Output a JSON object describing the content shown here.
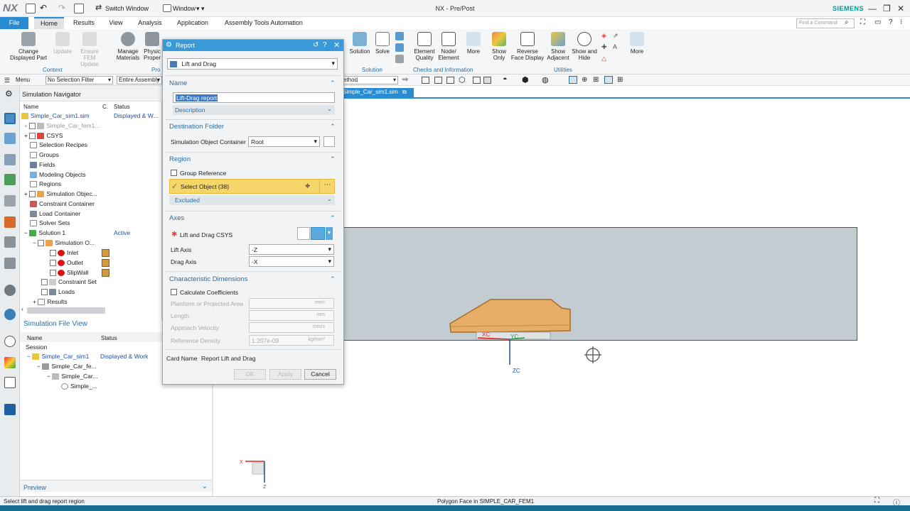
{
  "app": {
    "logo": "NX",
    "window_title": "NX - Pre/Post",
    "brand": "SIEMENS",
    "switch_window": "Switch Window",
    "window_menu": "Window"
  },
  "tabs": [
    "File",
    "Home",
    "Results",
    "View",
    "Analysis",
    "Application",
    "Assembly Tools Automation"
  ],
  "find_command": "Find a Command",
  "ribbon": {
    "change_part": "Change Displayed Part",
    "update": "Update",
    "update_fem": "Ensure FEM Update",
    "manage_materials": "Manage Materials",
    "physical": "Physic Proper",
    "solution": "Solution",
    "solve": "Solve",
    "element_quality": "Element Quality",
    "node_element": "Node/ Element",
    "more": "More",
    "show_only": "Show Only",
    "reverse_face": "Reverse Face Display",
    "show_adjacent": "Show Adjacent",
    "show_hide": "Show and Hide",
    "more2": "More",
    "groups": {
      "context": "Context",
      "prop": "Pro",
      "solution": "Solution",
      "checks": "Checks and Information",
      "utilities": "Utilities"
    }
  },
  "cmdbar": {
    "menu": "Menu",
    "filter": "No Selection Filter",
    "scope": "Entire Assembly",
    "method": "ethod"
  },
  "navigator": {
    "title": "Simulation Navigator",
    "col_name": "Name",
    "col_c": "C.",
    "col_status": "Status",
    "items": [
      {
        "label": "Simple_Car_sim1.sim",
        "status": "Displayed & W..."
      },
      {
        "label": "Simple_Car_fem1..."
      },
      {
        "label": "CSYS"
      },
      {
        "label": "Selection Recipes"
      },
      {
        "label": "Groups"
      },
      {
        "label": "Fields"
      },
      {
        "label": "Modeling Objects"
      },
      {
        "label": "Regions"
      },
      {
        "label": "Simulation Objec..."
      },
      {
        "label": "Constraint Container"
      },
      {
        "label": "Load Container"
      },
      {
        "label": "Solver Sets"
      },
      {
        "label": "Solution 1",
        "status": "Active"
      },
      {
        "label": "Simulation O..."
      },
      {
        "label": "Inlet"
      },
      {
        "label": "Outlet"
      },
      {
        "label": "SlipWall"
      },
      {
        "label": "Constraint Set"
      },
      {
        "label": "Loads"
      },
      {
        "label": "Results"
      }
    ]
  },
  "fileview": {
    "title": "Simulation File View",
    "col_name": "Name",
    "col_status": "Status",
    "session": "Session",
    "items": [
      {
        "label": "Simple_Car_sim1",
        "status": "Displayed & Work"
      },
      {
        "label": "Simple_Car_fe..."
      },
      {
        "label": "Simple_Car..."
      },
      {
        "label": "Simple_..."
      }
    ],
    "preview": "Preview"
  },
  "graphics": {
    "tab": "Simple_Car_sim1.sim",
    "xc": "XC",
    "yc": "YC",
    "zc": "ZC",
    "triad_x": "X",
    "triad_z": "Z"
  },
  "dialog": {
    "title": "Report",
    "type": "Lift and Drag",
    "name_section": "Name",
    "name_value": "Lift-Drag report",
    "description": "Description",
    "dest_section": "Destination Folder",
    "container_label": "Simulation Object Container",
    "container_value": "Root",
    "region_section": "Region",
    "group_reference": "Group Reference",
    "select_object": "Select Object (38)",
    "excluded": "Excluded",
    "axes_section": "Axes",
    "csys_label": "Lift and Drag CSYS",
    "lift_axis_label": "Lift Axis",
    "lift_axis": "-Z",
    "drag_axis_label": "Drag Axis",
    "drag_axis": "-X",
    "char_section": "Characteristic Dimensions",
    "calc_coeff": "Calculate Coefficients",
    "planform_label": "Planform or Projected Area",
    "planform_unit": "mm²",
    "length_label": "Length",
    "length_unit": "mm",
    "velocity_label": "Approach Velocity",
    "velocity_unit": "mm/s",
    "density_label": "Reference Density",
    "density_value": "1.207e-09",
    "density_unit": "kg/mm³",
    "card_label": "Card Name",
    "card_value": "Report Lift and Drag",
    "ok": "OK",
    "apply": "Apply",
    "cancel": "Cancel"
  },
  "status": {
    "left": "Select lift and drag report region",
    "center": "Polygon Face in SIMPLE_CAR_FEM1"
  },
  "colors": {
    "accent": "#2a8bd0",
    "highlight": "#f6d66b",
    "tunnel": "#c2ccd1",
    "car": "#e7ae68"
  }
}
